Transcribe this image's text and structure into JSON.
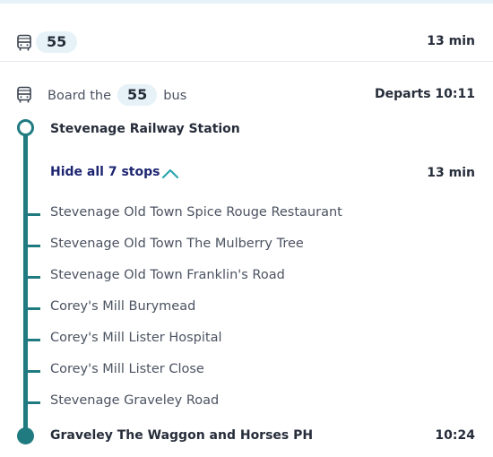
{
  "leg": {
    "route_number": "55",
    "duration": "13 min",
    "board_prefix": "Board the",
    "board_route": "55",
    "board_suffix": "bus",
    "departs": "Departs 10:11",
    "origin": "Stevenage Railway Station",
    "toggle_label": "Hide all 7 stops",
    "ride_duration": "13 min",
    "destination": "Graveley The Waggon and Horses PH",
    "arrival_time": "10:24"
  },
  "stops": [
    "Stevenage Old Town Spice Rouge Restaurant",
    "Stevenage Old Town The Mulberry Tree",
    "Stevenage Old Town Franklin's Road",
    "Corey's Mill Burymead",
    "Corey's Mill Lister Hospital",
    "Corey's Mill Lister Close",
    "Stevenage Graveley Road"
  ],
  "icons": {
    "bus": "bus-icon",
    "toggle": "chevron-up-icon"
  },
  "colors": {
    "timeline": "#1f7b80",
    "toggle_text": "#1d2571",
    "chevron": "#2aa6b0",
    "pill_bg": "#e6f2f7"
  }
}
